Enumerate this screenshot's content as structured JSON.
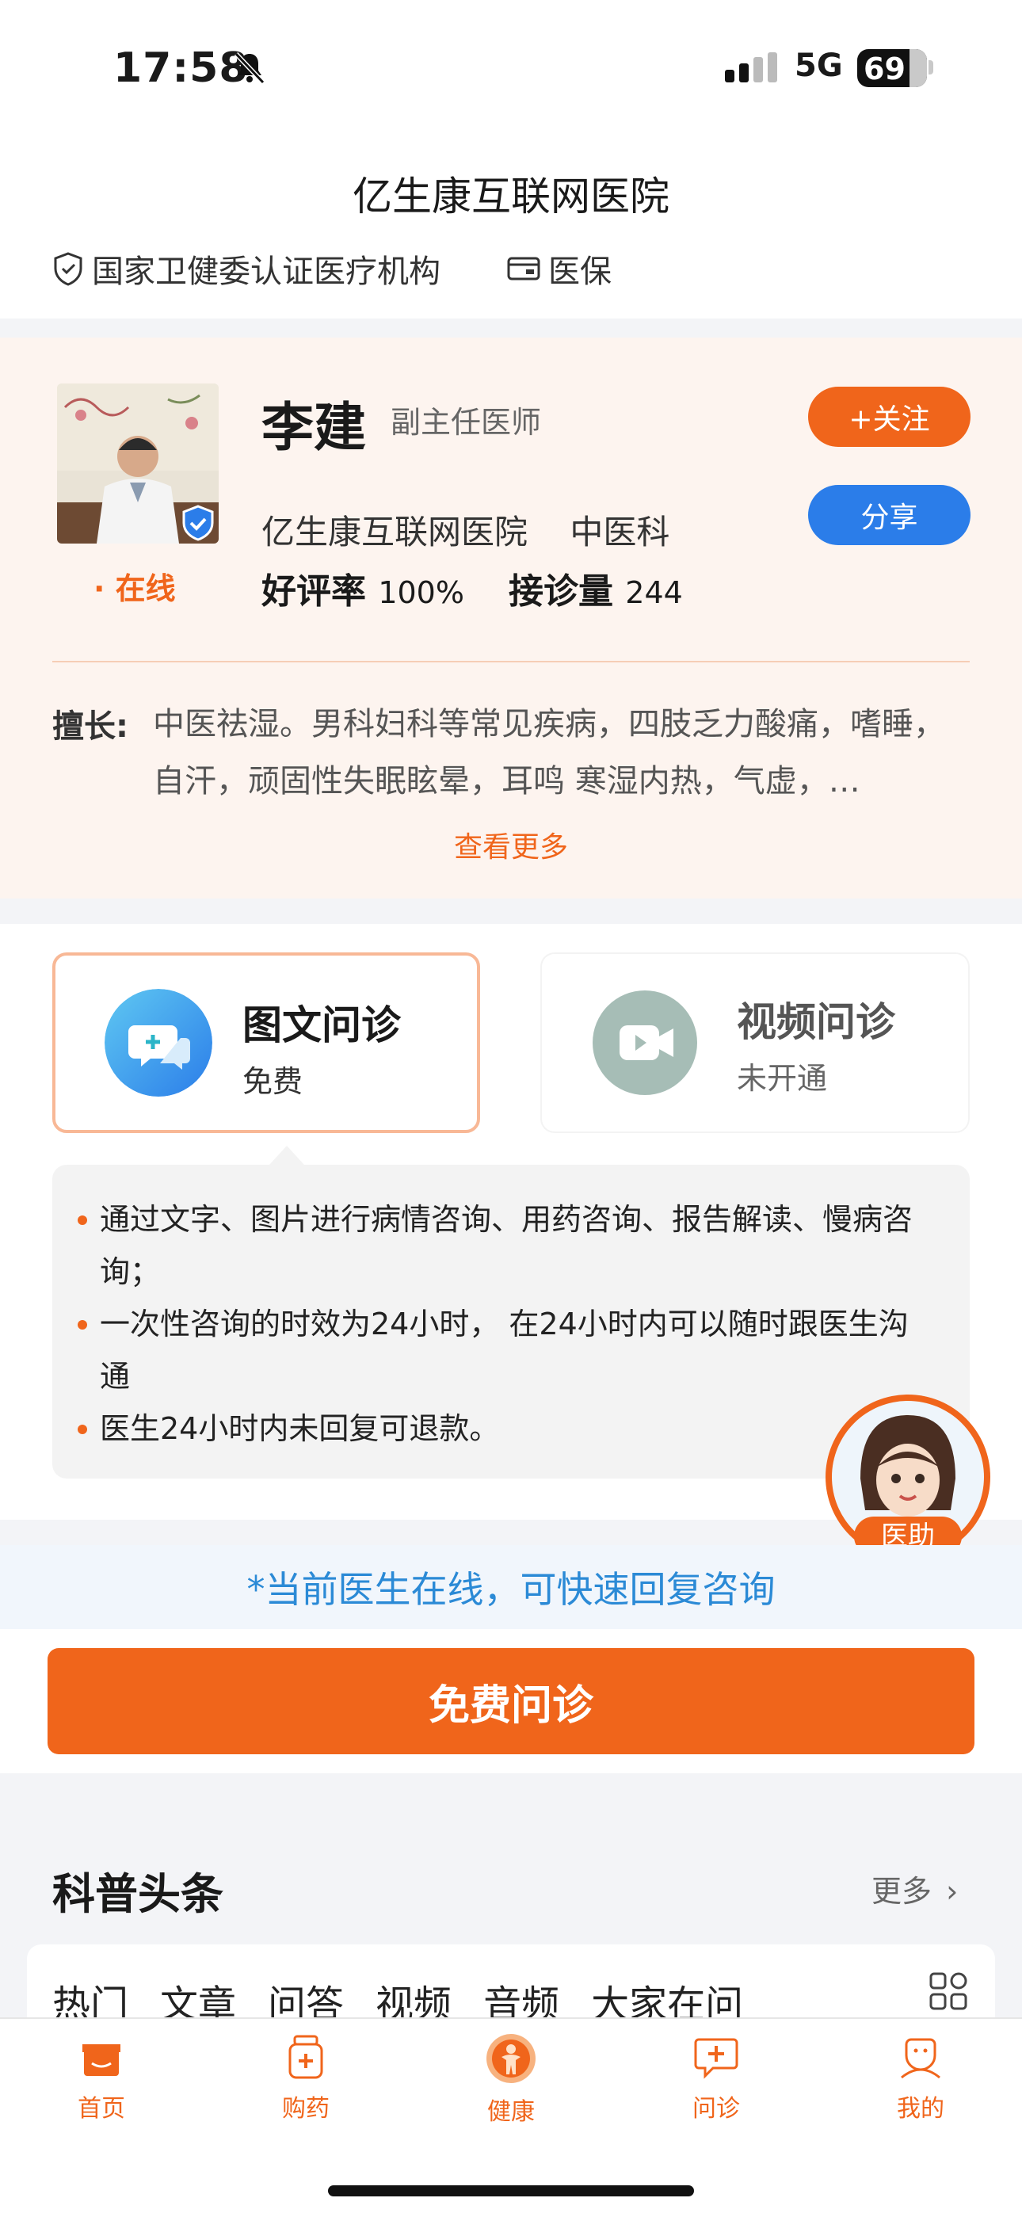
{
  "status_bar": {
    "time": "17:58",
    "network": "5G",
    "battery": "69"
  },
  "header": {
    "title": "亿生康互联网医院",
    "tags": [
      "国家卫健委认证医疗机构",
      "医保"
    ]
  },
  "doctor": {
    "name": "李建",
    "title": "副主任医师",
    "hospital": "亿生康互联网医院",
    "department": "中医科",
    "online": "· 在线",
    "rating_label": "好评率",
    "rating_value": "100%",
    "visits_label": "接诊量",
    "visits_value": "244",
    "follow_label": "+关注",
    "share_label": "分享",
    "specialty_label": "擅长:",
    "specialty_text": "中医祛湿。男科妇科等常见疾病，四肢乏力酸痛，嗜睡，自汗，顽固性失眠眩晕，耳鸣 寒湿内热，气虚，…",
    "more_label": "查看更多"
  },
  "consult": {
    "options": [
      {
        "title": "图文问诊",
        "sub": "免费"
      },
      {
        "title": "视频问诊",
        "sub": "未开通"
      }
    ],
    "description": [
      "通过文字、图片进行病情咨询、用药咨询、报告解读、慢病咨询；",
      "一次性咨询的时效为24小时， 在24小时内可以随时跟医生沟通",
      "医生24小时内未回复可退款。"
    ],
    "assistant_label": "医助",
    "notice": "*当前医生在线，可快速回复咨询",
    "main_button": "免费问诊"
  },
  "science": {
    "title": "科普头条",
    "more": "更多",
    "tabs": [
      "热门",
      "文章",
      "问答",
      "视频",
      "音频",
      "大家在问"
    ]
  },
  "nav": [
    {
      "label": "首页",
      "icon": "home-icon"
    },
    {
      "label": "购药",
      "icon": "medicine-icon"
    },
    {
      "label": "健康",
      "icon": "health-icon"
    },
    {
      "label": "问诊",
      "icon": "consult-icon"
    },
    {
      "label": "我的",
      "icon": "profile-icon"
    }
  ],
  "colors": {
    "accent": "#f0651b",
    "blue": "#2b7de9",
    "notice": "#2b8ad6"
  }
}
